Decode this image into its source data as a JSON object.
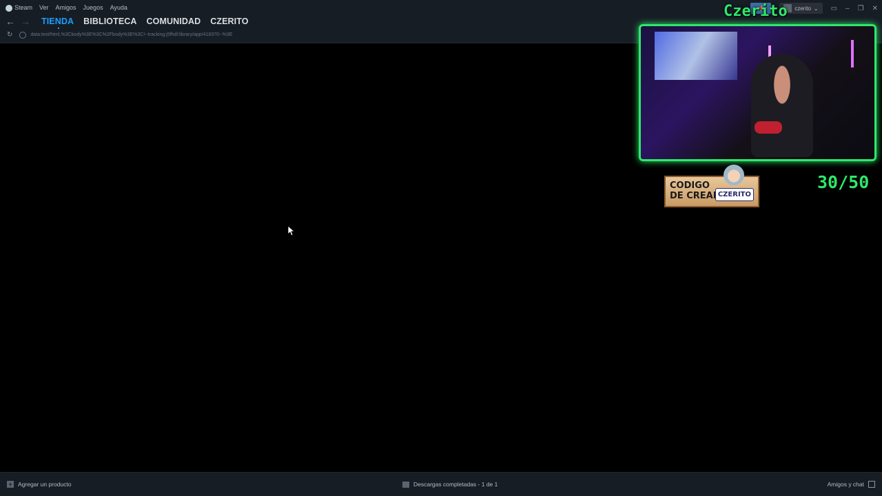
{
  "menu": {
    "items": [
      "Steam",
      "Ver",
      "Amigos",
      "Juegos",
      "Ayuda"
    ]
  },
  "nav": {
    "tabs": [
      {
        "label": "TIENDA",
        "active": true
      },
      {
        "label": "BIBLIOTECA",
        "active": false
      },
      {
        "label": "COMUNIDAD",
        "active": false
      },
      {
        "label": "CZERITO",
        "active": false
      }
    ]
  },
  "url": {
    "value": "data:text/html,%3Cbody%3E%3C%2Fbody%3E%3C!--tracking:j5fhdl:library/app/418370--%3E"
  },
  "account": {
    "username": "czerito"
  },
  "overlay": {
    "streamer_name": "Czerito",
    "creator_badge_line1": "CODIGO",
    "creator_badge_line2": "DE CREADOR",
    "creator_badge_tag": "CZERITO",
    "counter": "30/50",
    "accent_color": "#2ee86a"
  },
  "bottom": {
    "add_product": "Agregar un producto",
    "downloads": "Descargas completadas - 1 de 1",
    "friends_chat": "Amigos y chat"
  },
  "colors": {
    "titlebar_bg": "#171d25",
    "active_tab": "#1a9fff",
    "content_bg": "#000000"
  }
}
